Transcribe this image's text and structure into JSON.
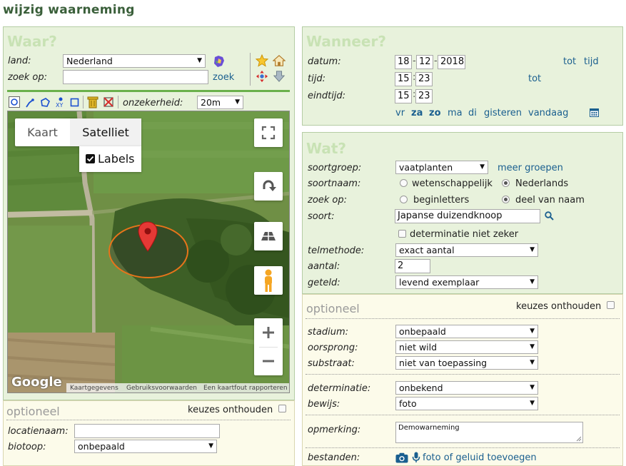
{
  "page_title": "wijzig waarneming",
  "waar": {
    "heading": "Waar?",
    "land_label": "land:",
    "land_value": "Nederland",
    "zoek_label": "zoek op:",
    "zoek_value": "",
    "zoek_link": "zoek",
    "onzekerheid_label": "onzekerheid:",
    "onzekerheid_value": "20m",
    "xy_label": "XY"
  },
  "map": {
    "tab_kaart": "Kaart",
    "tab_satelliet": "Satelliet",
    "labels_label": "Labels",
    "google": "Google",
    "footer_1": "Kaartgegevens",
    "footer_2": "Gebruiksvoorwaarden",
    "footer_3": "Een kaartfout rapporteren"
  },
  "waar_optioneel": {
    "heading": "optioneel",
    "remember": "keuzes onthouden",
    "locatienaam_label": "locatienaam:",
    "locatienaam_value": "",
    "biotoop_label": "biotoop:",
    "biotoop_value": "onbepaald"
  },
  "wanneer": {
    "heading": "Wanneer?",
    "datum_label": "datum:",
    "datum_d": "18",
    "datum_m": "12",
    "datum_y": "2018",
    "tot": "tot",
    "tijd_link": "tijd",
    "tijd_label": "tijd:",
    "tijd_h": "15",
    "tijd_m": "23",
    "tot2": "tot",
    "eindtijd_label": "eindtijd:",
    "eind_h": "15",
    "eind_m": "23",
    "days": [
      "vr",
      "za",
      "zo",
      "ma",
      "di",
      "gisteren",
      "vandaag"
    ]
  },
  "wat": {
    "heading": "Wat?",
    "soortgroep_label": "soortgroep:",
    "soortgroep_value": "vaatplanten",
    "meer_groepen": "meer groepen",
    "soortnaam_label": "soortnaam:",
    "opt_wetenschappelijk": "wetenschappelijk",
    "opt_nederlands": "Nederlands",
    "zoek_label": "zoek op:",
    "opt_beginletters": "beginletters",
    "opt_deel": "deel van naam",
    "soort_label": "soort:",
    "soort_value": "Japanse duizendknoop",
    "determinatie_check": "determinatie niet zeker",
    "telmethode_label": "telmethode:",
    "telmethode_value": "exact aantal",
    "aantal_label": "aantal:",
    "aantal_value": "2",
    "geteld_label": "geteld:",
    "geteld_value": "levend exemplaar"
  },
  "wat_optioneel": {
    "heading": "optioneel",
    "remember": "keuzes onthouden",
    "stadium_label": "stadium:",
    "stadium_value": "onbepaald",
    "oorsprong_label": "oorsprong:",
    "oorsprong_value": "niet wild",
    "substraat_label": "substraat:",
    "substraat_value": "niet van toepassing",
    "determinatie_label": "determinatie:",
    "determinatie_value": "onbekend",
    "bewijs_label": "bewijs:",
    "bewijs_value": "foto",
    "opmerking_label": "opmerking:",
    "opmerking_value": "Demowarneming",
    "bestanden_label": "bestanden:",
    "bestanden_link": "foto of geluid toevoegen"
  },
  "colors": {
    "panel_bg": "#e8f2dc",
    "optional_bg": "#fcfbea",
    "heading_green": "#c8e2b4",
    "link_blue": "#1a5f8f"
  }
}
